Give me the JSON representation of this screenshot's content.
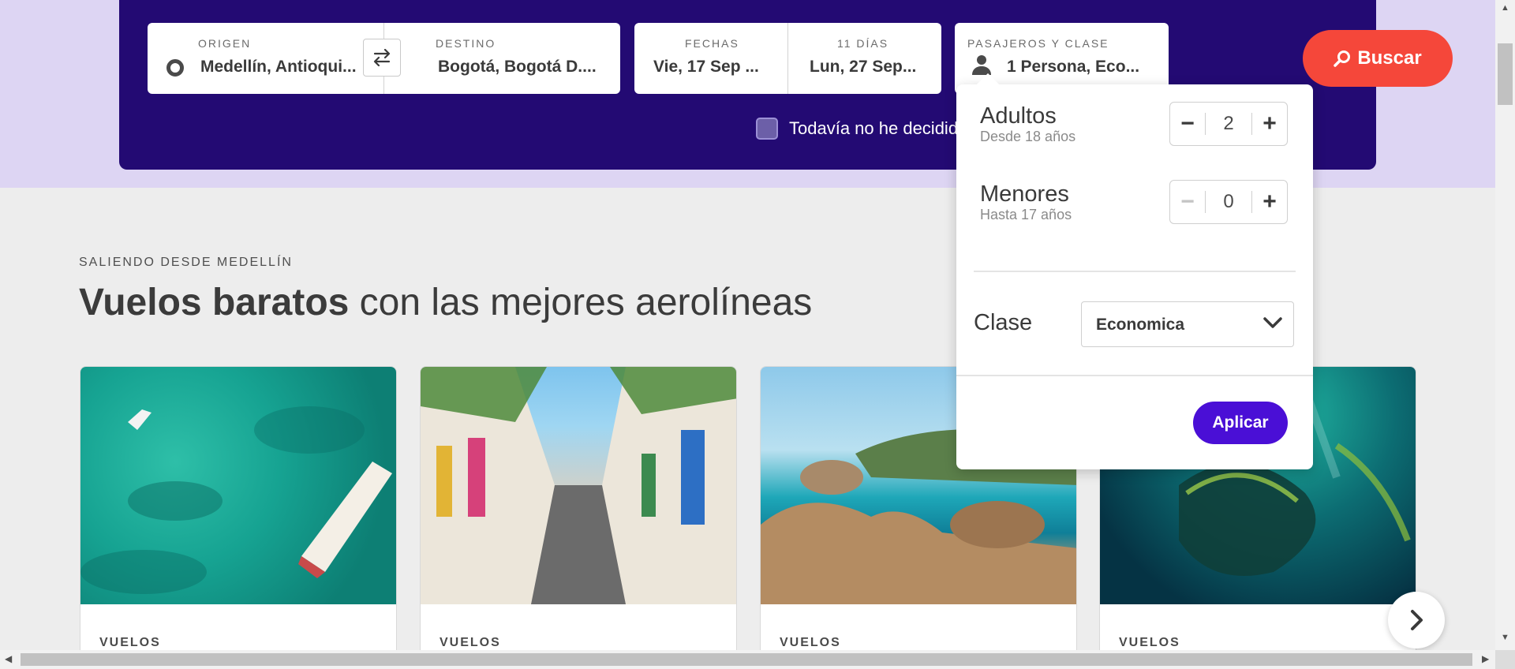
{
  "search": {
    "origin_label": "ORIGEN",
    "origin_value": "Medellín, Antioqui...",
    "destination_label": "DESTINO",
    "destination_value": "Bogotá, Bogotá D....",
    "dates_label": "FECHAS",
    "dates_value": "Vie, 17 Sep ...",
    "duration_label": "11 DÍAS",
    "return_value": "Lun, 27 Sep...",
    "passengers_label": "PASAJEROS Y CLASE",
    "passengers_value": "1 Persona, Eco...",
    "search_button": "Buscar",
    "undecided_label": "Todavía no he decidido la fecha",
    "undecided_checked": false
  },
  "passenger_popover": {
    "adults_title": "Adultos",
    "adults_sub": "Desde 18 años",
    "adults_count": "2",
    "minors_title": "Menores",
    "minors_sub": "Hasta 17 años",
    "minors_count": "0",
    "class_label": "Clase",
    "class_value": "Economica",
    "apply_button": "Aplicar"
  },
  "section": {
    "eyebrow": "SALIENDO DESDE MEDELLÍN",
    "headline_bold": "Vuelos baratos",
    "headline_rest": " con las mejores aerolíneas"
  },
  "cards": [
    {
      "tag": "VUELOS"
    },
    {
      "tag": "VUELOS"
    },
    {
      "tag": "VUELOS"
    },
    {
      "tag": "VUELOS"
    }
  ],
  "colors": {
    "panel": "#230a73",
    "band": "#ddd5f3",
    "search_button": "#f5473a",
    "apply_button": "#4a0fd6"
  }
}
